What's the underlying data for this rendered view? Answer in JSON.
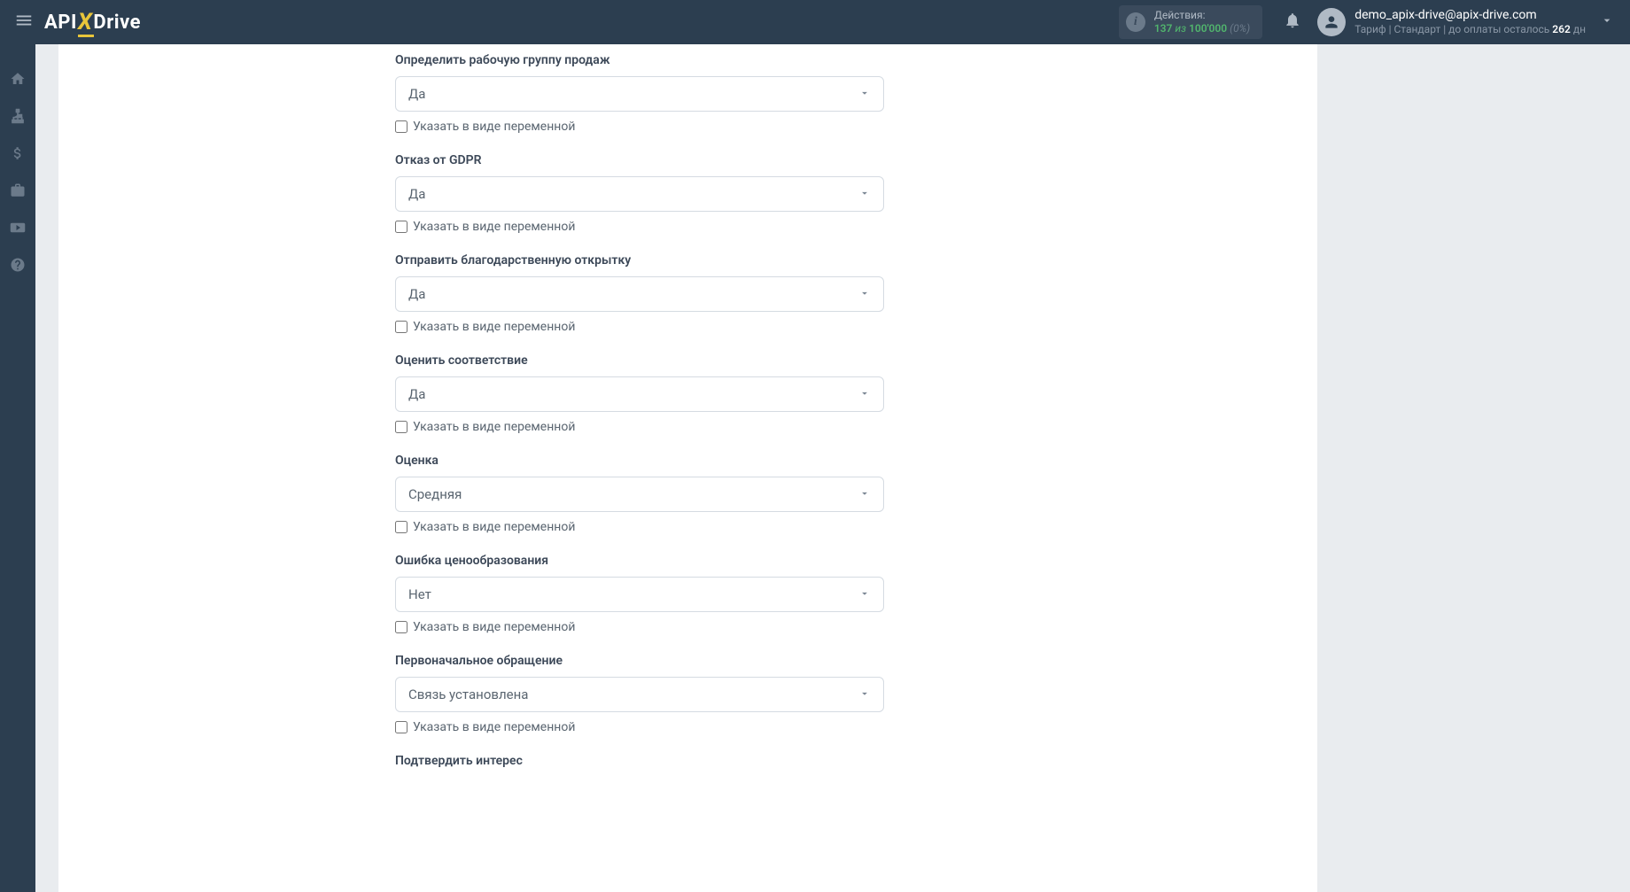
{
  "header": {
    "logo": {
      "api": "API",
      "x": "X",
      "drive": "Drive"
    },
    "actions": {
      "label": "Действия:",
      "count": "137",
      "of_word": "из",
      "limit": "100'000",
      "pct": "(0%)"
    },
    "user": {
      "email": "demo_apix-drive@apix-drive.com",
      "tariff_prefix": "Тариф | Стандарт | до оплаты осталось ",
      "days": "262",
      "tariff_suffix": " дн"
    }
  },
  "form": {
    "checkbox_label": "Указать в виде переменной",
    "fields": [
      {
        "label": "Определить рабочую группу продаж",
        "value": "Да"
      },
      {
        "label": "Отказ от GDPR",
        "value": "Да"
      },
      {
        "label": "Отправить благодарственную открытку",
        "value": "Да"
      },
      {
        "label": "Оценить соответствие",
        "value": "Да"
      },
      {
        "label": "Оценка",
        "value": "Средняя"
      },
      {
        "label": "Ошибка ценообразования",
        "value": "Нет"
      },
      {
        "label": "Первоначальное обращение",
        "value": "Связь установлена"
      },
      {
        "label": "Подтвердить интерес",
        "value": ""
      }
    ]
  }
}
